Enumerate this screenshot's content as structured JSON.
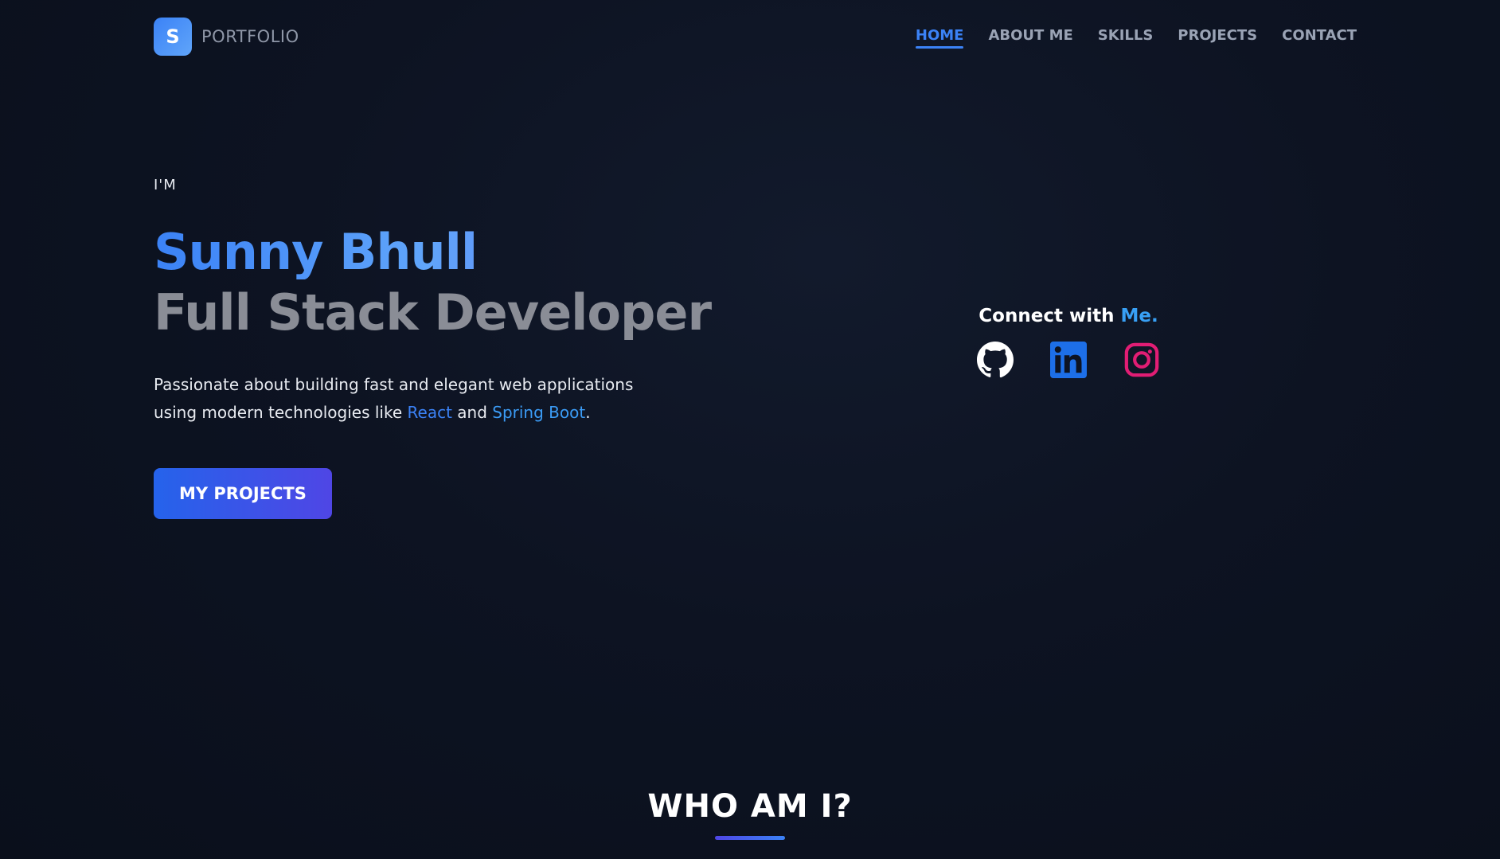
{
  "brand": {
    "badge_letter": "S",
    "name": "PORTFOLIO"
  },
  "nav": {
    "items": [
      {
        "label": "HOME",
        "active": true
      },
      {
        "label": "ABOUT ME",
        "active": false
      },
      {
        "label": "SKILLS",
        "active": false
      },
      {
        "label": "PROJECTS",
        "active": false
      },
      {
        "label": "CONTACT",
        "active": false
      }
    ]
  },
  "hero": {
    "intro": "I'M",
    "name": "Sunny Bhull",
    "role": "Full Stack Developer",
    "desc_part1": "Passionate about building fast and elegant web applications using modern technologies like ",
    "tech1": "React",
    "desc_and": " and ",
    "tech2": "Spring Boot",
    "desc_end": ".",
    "cta_label": "MY PROJECTS"
  },
  "connect": {
    "title_prefix": "Connect with ",
    "title_accent": "Me.",
    "socials": [
      {
        "name": "github",
        "icon": "github-icon",
        "color": "#ffffff"
      },
      {
        "name": "linkedin",
        "icon": "linkedin-icon",
        "color": "#1d6fe8"
      },
      {
        "name": "instagram",
        "icon": "instagram-icon",
        "color": "#e11d74"
      }
    ]
  },
  "who": {
    "title": "WHO AM I?"
  },
  "colors": {
    "accent": "#3b82f6",
    "background": "#0d1322"
  }
}
